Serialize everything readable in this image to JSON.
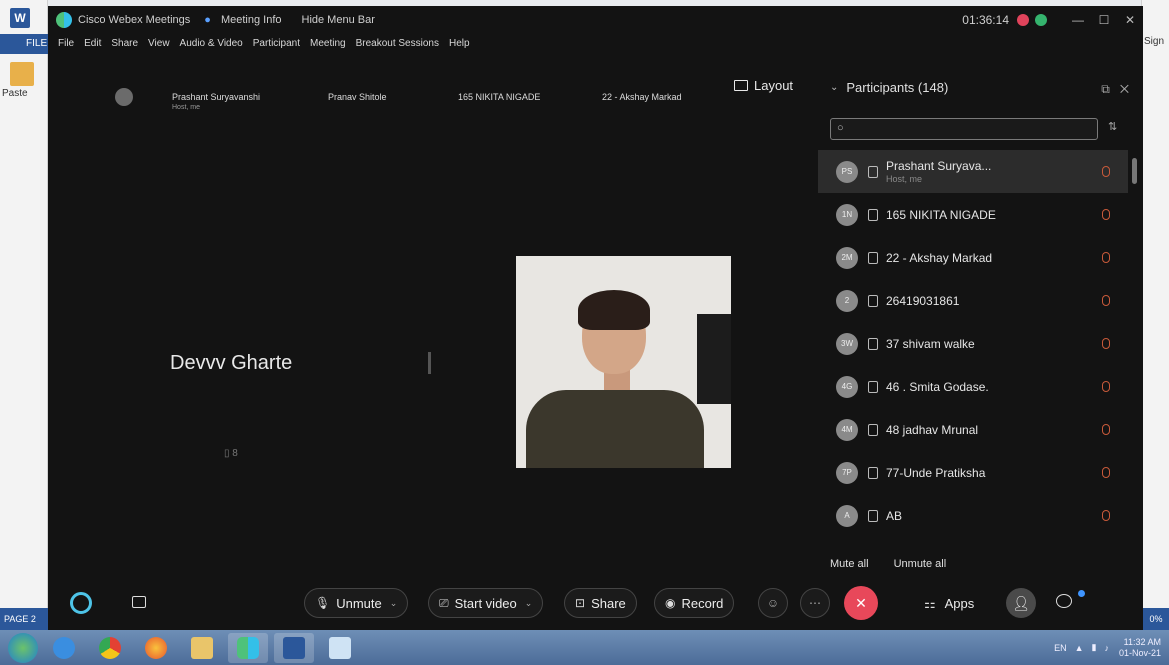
{
  "word": {
    "file_tab": "FILE",
    "paste_label": "Paste",
    "page_label": "PAGE 2",
    "sign_label": "Sign",
    "zoom_label": "0%"
  },
  "webex": {
    "title": "Cisco Webex Meetings",
    "meeting_info": "Meeting Info",
    "hide_menu_bar": "Hide Menu Bar",
    "timer": "01:36:14",
    "menu": [
      "File",
      "Edit",
      "Share",
      "View",
      "Audio & Video",
      "Participant",
      "Meeting",
      "Breakout Sessions",
      "Help"
    ],
    "strip": [
      {
        "name": "Prashant Suryavanshi",
        "sub": "Host, me"
      },
      {
        "name": "Pranav Shitole",
        "sub": ""
      },
      {
        "name": "165 NIKITA NIGADE",
        "sub": ""
      },
      {
        "name": "22 - Akshay Markad",
        "sub": ""
      }
    ],
    "layout_label": "Layout",
    "active_speaker": "Devvv Gharte",
    "active_speaker_mute": "8"
  },
  "participants": {
    "header": "Participants (148)",
    "search_placeholder": "",
    "items": [
      {
        "initials": "PS",
        "name": "Prashant Suryava...",
        "sub": "Host, me",
        "active": true
      },
      {
        "initials": "1N",
        "name": "165 NIKITA NIGADE",
        "sub": "",
        "active": false
      },
      {
        "initials": "2M",
        "name": "22 - Akshay Markad",
        "sub": "",
        "active": false
      },
      {
        "initials": "2",
        "name": "26419031861",
        "sub": "",
        "active": false
      },
      {
        "initials": "3W",
        "name": "37 shivam walke",
        "sub": "",
        "active": false
      },
      {
        "initials": "4G",
        "name": "46 . Smita Godase.",
        "sub": "",
        "active": false
      },
      {
        "initials": "4M",
        "name": "48 jadhav Mrunal",
        "sub": "",
        "active": false
      },
      {
        "initials": "7P",
        "name": "77-Unde Pratiksha",
        "sub": "",
        "active": false
      },
      {
        "initials": "A",
        "name": "AB",
        "sub": "",
        "active": false
      }
    ],
    "mute_all": "Mute all",
    "unmute_all": "Unmute all"
  },
  "controls": {
    "unmute": "Unmute",
    "start_video": "Start video",
    "share": "Share",
    "record": "Record",
    "apps": "Apps"
  },
  "tray": {
    "lang": "EN",
    "time": "11:32 AM",
    "date": "01-Nov-21"
  }
}
